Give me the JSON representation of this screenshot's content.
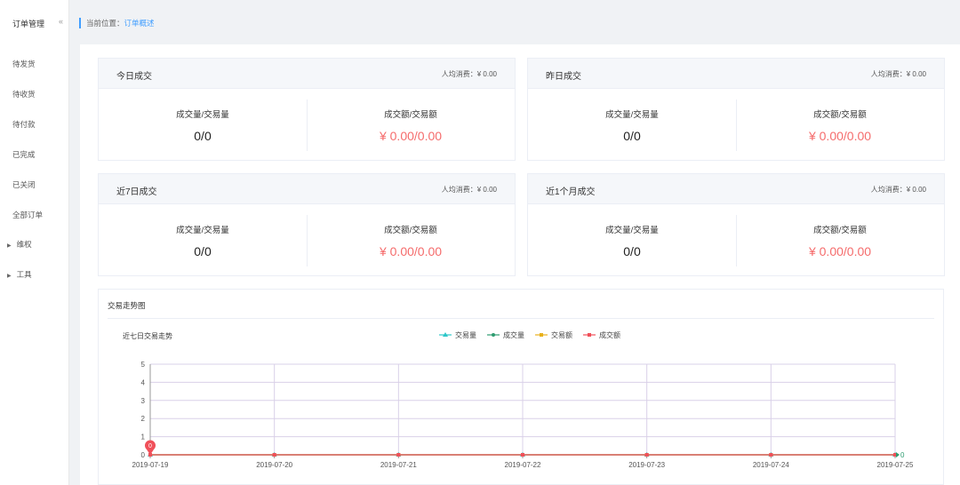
{
  "sidebar": {
    "title": "订单管理",
    "collapse_icon": "«",
    "items": [
      {
        "label": "待发货"
      },
      {
        "label": "待收货"
      },
      {
        "label": "待付款"
      },
      {
        "label": "已完成"
      },
      {
        "label": "已关闭"
      },
      {
        "label": "全部订单"
      },
      {
        "label": "维权",
        "expandable": true
      },
      {
        "label": "工具",
        "expandable": true
      }
    ]
  },
  "breadcrumb": {
    "prefix": "当前位置：",
    "current": "订单概述"
  },
  "cards": [
    {
      "title": "今日成交",
      "avg": "人均消费：¥ 0.00",
      "left_label": "成交量/交易量",
      "left_value": "0/0",
      "right_label": "成交额/交易额",
      "right_value": "¥ 0.00/0.00"
    },
    {
      "title": "昨日成交",
      "avg": "人均消费：¥ 0.00",
      "left_label": "成交量/交易量",
      "left_value": "0/0",
      "right_label": "成交额/交易额",
      "right_value": "¥ 0.00/0.00"
    },
    {
      "title": "近7日成交",
      "avg": "人均消费：¥ 0.00",
      "left_label": "成交量/交易量",
      "left_value": "0/0",
      "right_label": "成交额/交易额",
      "right_value": "¥ 0.00/0.00"
    },
    {
      "title": "近1个月成交",
      "avg": "人均消费：¥ 0.00",
      "left_label": "成交量/交易量",
      "left_value": "0/0",
      "right_label": "成交额/交易额",
      "right_value": "¥ 0.00/0.00"
    }
  ],
  "trend": {
    "section_title": "交易走势图"
  },
  "colors": {
    "accent": "#409eff",
    "red": "#f56c6c"
  },
  "chart_data": {
    "type": "line",
    "title": "近七日交易走势",
    "categories": [
      "2019-07-19",
      "2019-07-20",
      "2019-07-21",
      "2019-07-22",
      "2019-07-23",
      "2019-07-24",
      "2019-07-25"
    ],
    "ylim": [
      0,
      5
    ],
    "yticks": [
      0,
      1,
      2,
      3,
      4,
      5
    ],
    "legend_position": "top-center",
    "series": [
      {
        "name": "交易量",
        "values": [
          0,
          0,
          0,
          0,
          0,
          0,
          0
        ],
        "color": "#2ec7c9",
        "marker": "triangle"
      },
      {
        "name": "成交量",
        "values": [
          0,
          0,
          0,
          0,
          0,
          0,
          0
        ],
        "color": "#2e9c70",
        "marker": "circle"
      },
      {
        "name": "交易额",
        "values": [
          0,
          0,
          0,
          0,
          0,
          0,
          0
        ],
        "color": "#e8b11c",
        "marker": "square"
      },
      {
        "name": "成交额",
        "values": [
          0,
          0,
          0,
          0,
          0,
          0,
          0
        ],
        "color": "#f0505a",
        "marker": "square"
      }
    ],
    "annotations": [
      {
        "type": "pin",
        "value": "0",
        "category": "2019-07-19",
        "color": "#f0505a"
      },
      {
        "type": "end-label",
        "value": "0",
        "category": "2019-07-25",
        "color": "#2e9c70"
      }
    ]
  }
}
